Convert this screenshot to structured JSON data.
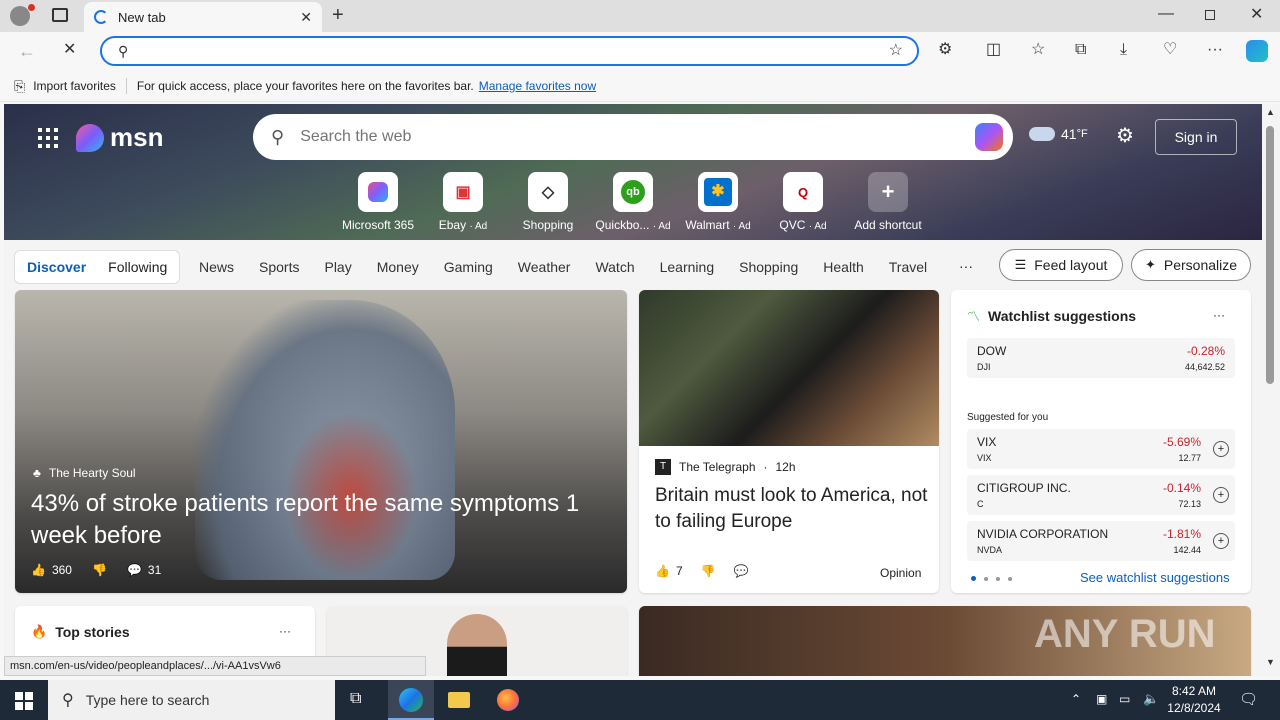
{
  "browser": {
    "tab_title": "New tab",
    "address_value": "",
    "favbar": {
      "import_label": "Import favorites",
      "message": "For quick access, place your favorites here on the favorites bar.",
      "manage_link": "Manage favorites now"
    }
  },
  "msn": {
    "logo": "msn",
    "search_placeholder": "Search the web",
    "weather_temp": "41",
    "weather_unit": "°F",
    "sign_in": "Sign in",
    "shortcuts": [
      {
        "label": "Microsoft 365",
        "ad": ""
      },
      {
        "label": "Ebay",
        "ad": "· Ad"
      },
      {
        "label": "Shopping",
        "ad": ""
      },
      {
        "label": "Quickbo...",
        "ad": "· Ad"
      },
      {
        "label": "Walmart",
        "ad": "· Ad"
      },
      {
        "label": "QVC",
        "ad": "· Ad"
      },
      {
        "label": "Add shortcut",
        "ad": ""
      }
    ],
    "nav": {
      "discover": "Discover",
      "following": "Following",
      "items": [
        "News",
        "Sports",
        "Play",
        "Money",
        "Gaming",
        "Weather",
        "Watch",
        "Learning",
        "Shopping",
        "Health",
        "Travel"
      ],
      "more": "···",
      "feed_layout": "Feed layout",
      "personalize": "Personalize"
    },
    "hero_article": {
      "source": "The Hearty Soul",
      "title": "43% of stroke patients report the same symptoms 1 week before",
      "likes": "360",
      "comments": "31"
    },
    "side_article": {
      "source": "The Telegraph",
      "time": "12h",
      "title": "Britain must look to America, not to failing Europe",
      "likes": "7",
      "tag": "Opinion"
    },
    "watchlist": {
      "title": "Watchlist suggestions",
      "more": "···",
      "main": {
        "name": "DOW",
        "ticker": "DJI",
        "change": "-0.28%",
        "price": "44,642.52"
      },
      "suggested_label": "Suggested for you",
      "suggested": [
        {
          "name": "VIX",
          "ticker": "VIX",
          "change": "-5.69%",
          "price": "12.77"
        },
        {
          "name": "CITIGROUP INC.",
          "ticker": "C",
          "change": "-0.14%",
          "price": "72.13"
        },
        {
          "name": "NVIDIA CORPORATION",
          "ticker": "NVDA",
          "change": "-1.81%",
          "price": "142.44"
        }
      ],
      "see_link": "See watchlist suggestions"
    },
    "top_stories": {
      "title": "Top stories",
      "more": "···"
    },
    "status_url": "msn.com/en-us/video/peopleandplaces/.../vi-AA1vsVw6"
  },
  "taskbar": {
    "search_placeholder": "Type here to search",
    "time": "8:42 AM",
    "date": "12/8/2024"
  },
  "watermark": "ANY RUN",
  "colors": {
    "accent": "#1a73e8",
    "negative": "#c4262e",
    "taskbar": "#1f2a38"
  }
}
